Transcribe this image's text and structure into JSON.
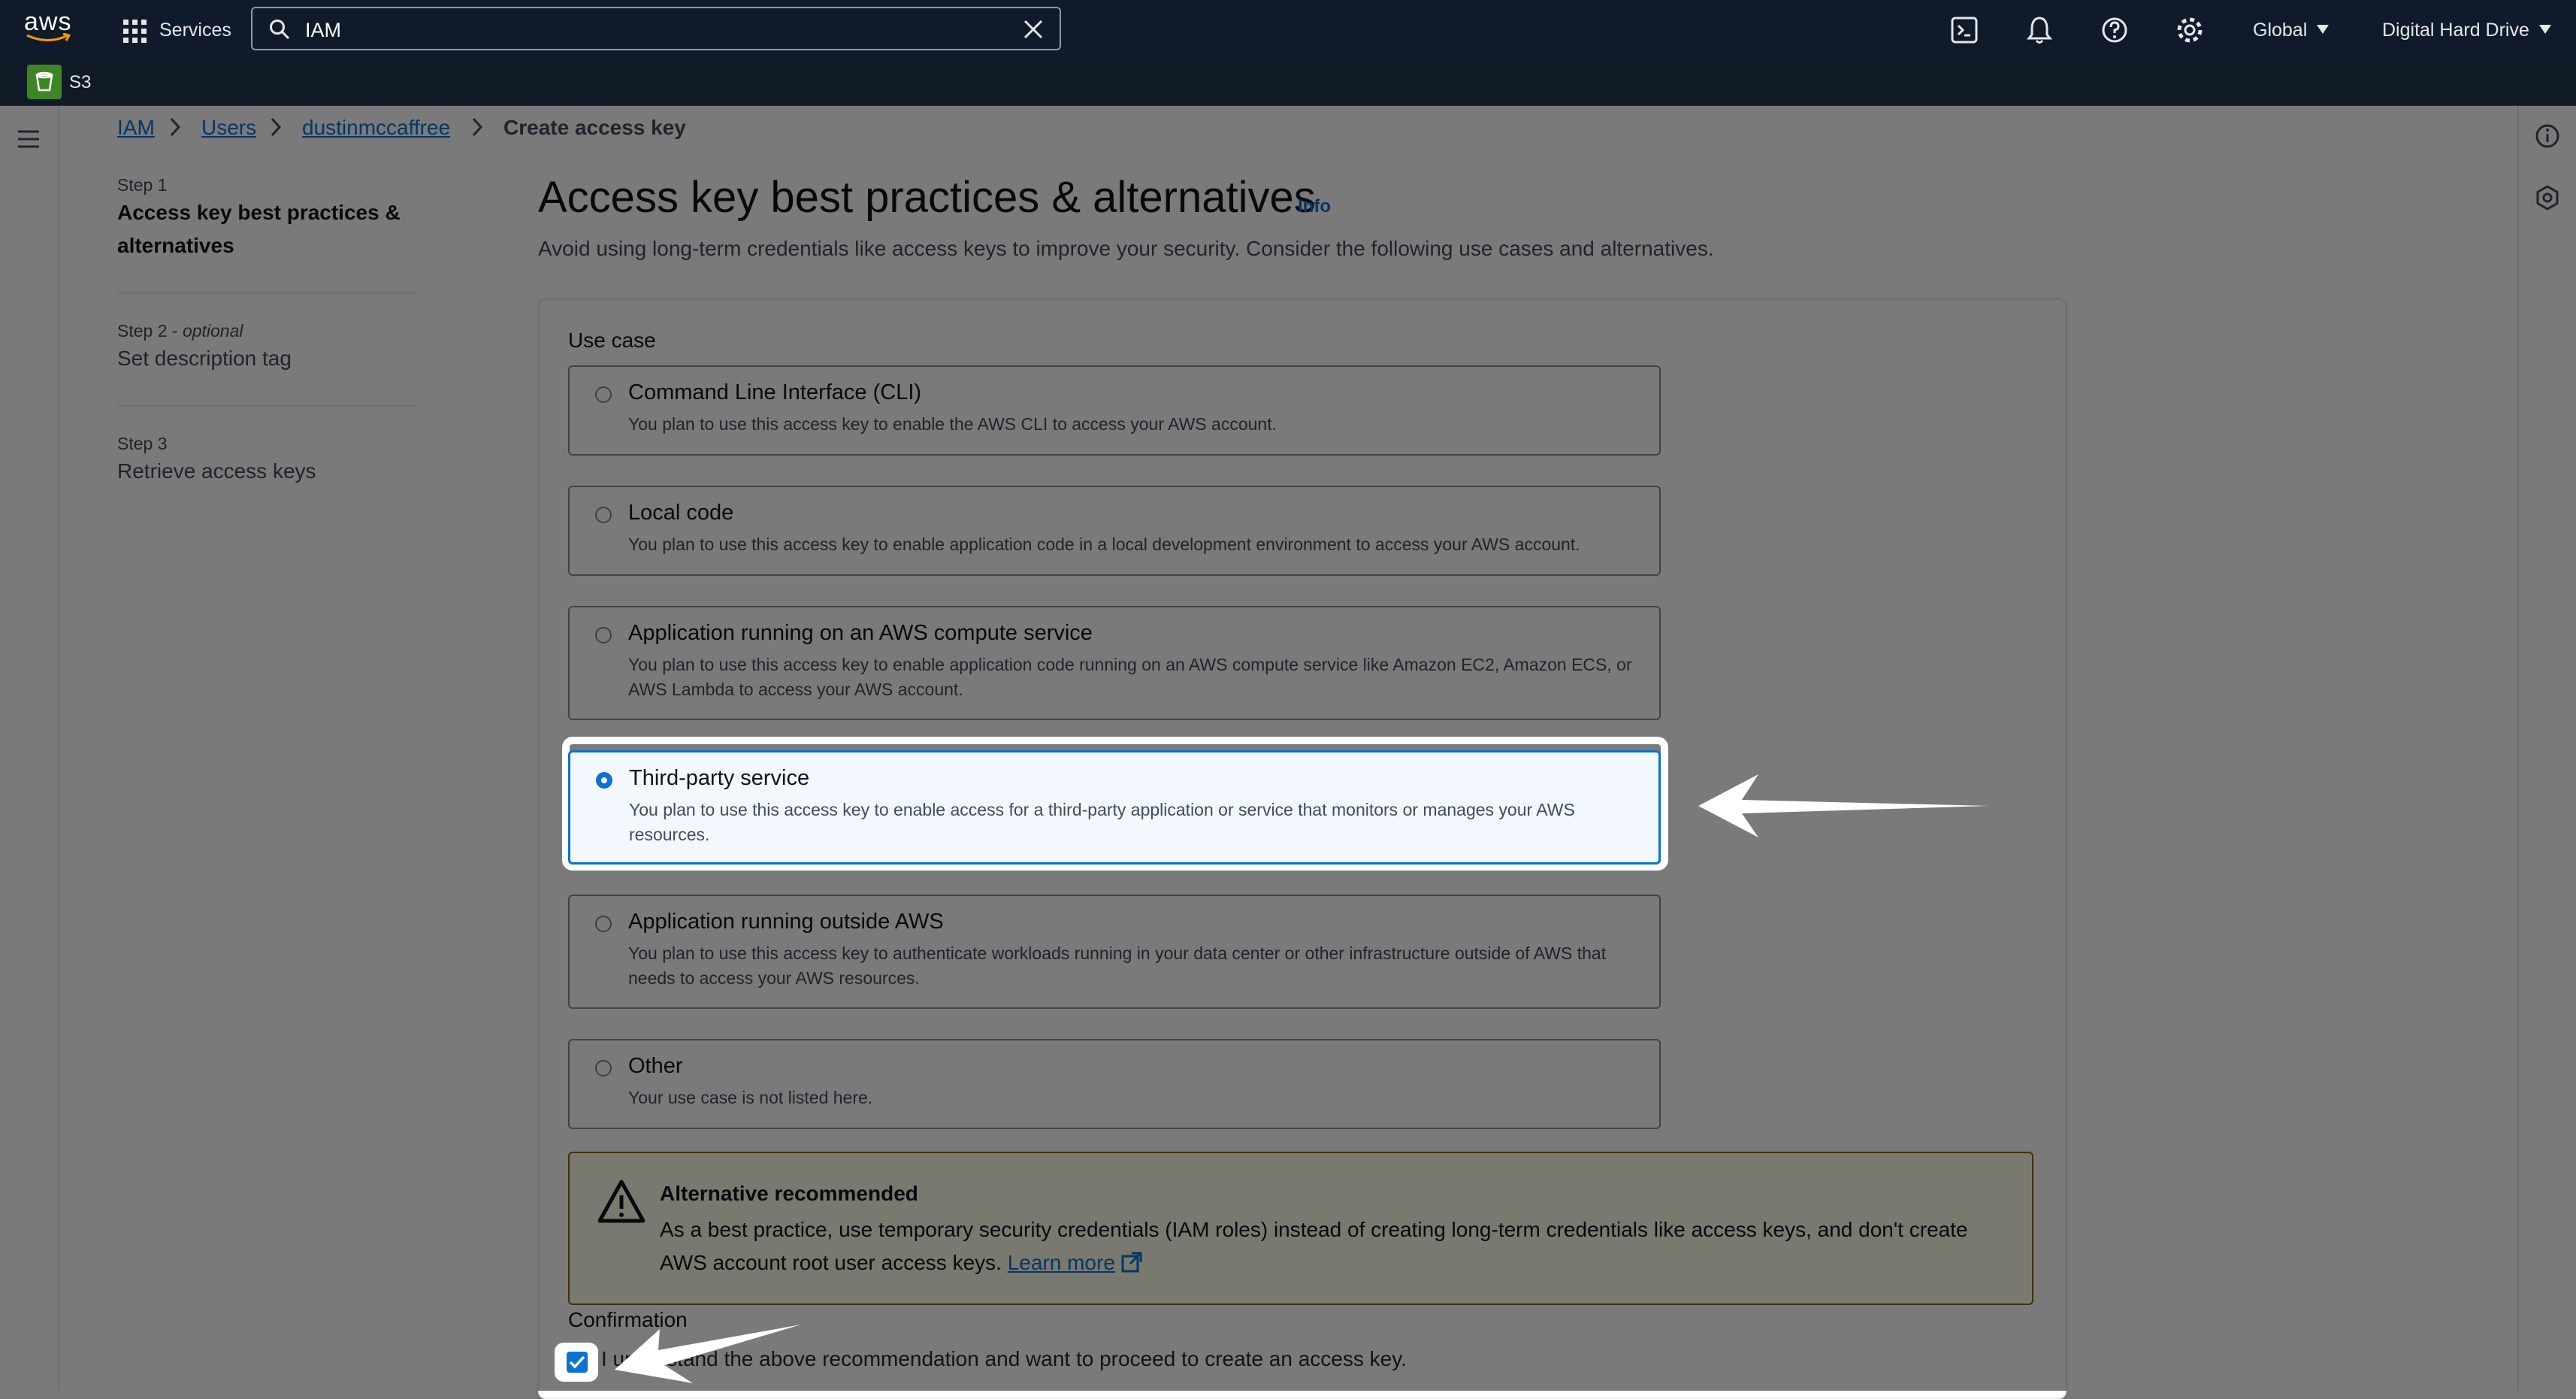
{
  "topnav": {
    "logo_text": "aws",
    "services_label": "Services",
    "search_value": "IAM",
    "region_label": "Global",
    "account_label": "Digital Hard Drive",
    "icons": [
      "grid-icon",
      "search-icon",
      "clear-icon",
      "cloudshell-icon",
      "bell-icon",
      "help-icon",
      "settings-icon",
      "caret-down-icon"
    ]
  },
  "subnav": {
    "service_favorite": "S3"
  },
  "breadcrumb": {
    "items": [
      "IAM",
      "Users",
      "dustinmccaffree",
      "Create access key"
    ]
  },
  "steps": [
    {
      "label": "Step 1",
      "title": "Access key best practices & alternatives"
    },
    {
      "label": "Step 2 - ",
      "label_optional": "optional",
      "title": "Set description tag"
    },
    {
      "label": "Step 3",
      "title": "Retrieve access keys"
    }
  ],
  "main": {
    "heading": "Access key best practices & alternatives",
    "info_label": "Info",
    "intro": "Avoid using long-term credentials like access keys to improve your security. Consider the following use cases and alternatives.",
    "use_case_label": "Use case",
    "options": [
      {
        "title": "Command Line Interface (CLI)",
        "desc": "You plan to use this access key to enable the AWS CLI to access your AWS account.",
        "selected": false
      },
      {
        "title": "Local code",
        "desc": "You plan to use this access key to enable application code in a local development environment to access your AWS account.",
        "selected": false
      },
      {
        "title": "Application running on an AWS compute service",
        "desc": "You plan to use this access key to enable application code running on an AWS compute service like Amazon EC2, Amazon ECS, or AWS Lambda to access your AWS account.",
        "selected": false
      },
      {
        "title": "Third-party service",
        "desc": "You plan to use this access key to enable access for a third-party application or service that monitors or manages your AWS resources.",
        "selected": true
      },
      {
        "title": "Application running outside AWS",
        "desc": "You plan to use this access key to authenticate workloads running in your data center or other infrastructure outside of AWS that needs to access your AWS resources.",
        "selected": false
      },
      {
        "title": "Other",
        "desc": "Your use case is not listed here.",
        "selected": false
      }
    ],
    "alert": {
      "title": "Alternative recommended",
      "body": "As a best practice, use temporary security credentials (IAM roles) instead of creating long-term credentials like access keys, and don't create AWS account root user access keys.",
      "link": "Learn more"
    },
    "confirmation_label": "Confirmation",
    "confirmation_text": "I understand the above recommendation and want to proceed to create an access key.",
    "confirmation_checked": true
  },
  "colors": {
    "nav_bg": "#0f1b2a",
    "accent": "#0972d3",
    "warning_border": "#8d6605",
    "warning_bg": "#fffce9"
  }
}
